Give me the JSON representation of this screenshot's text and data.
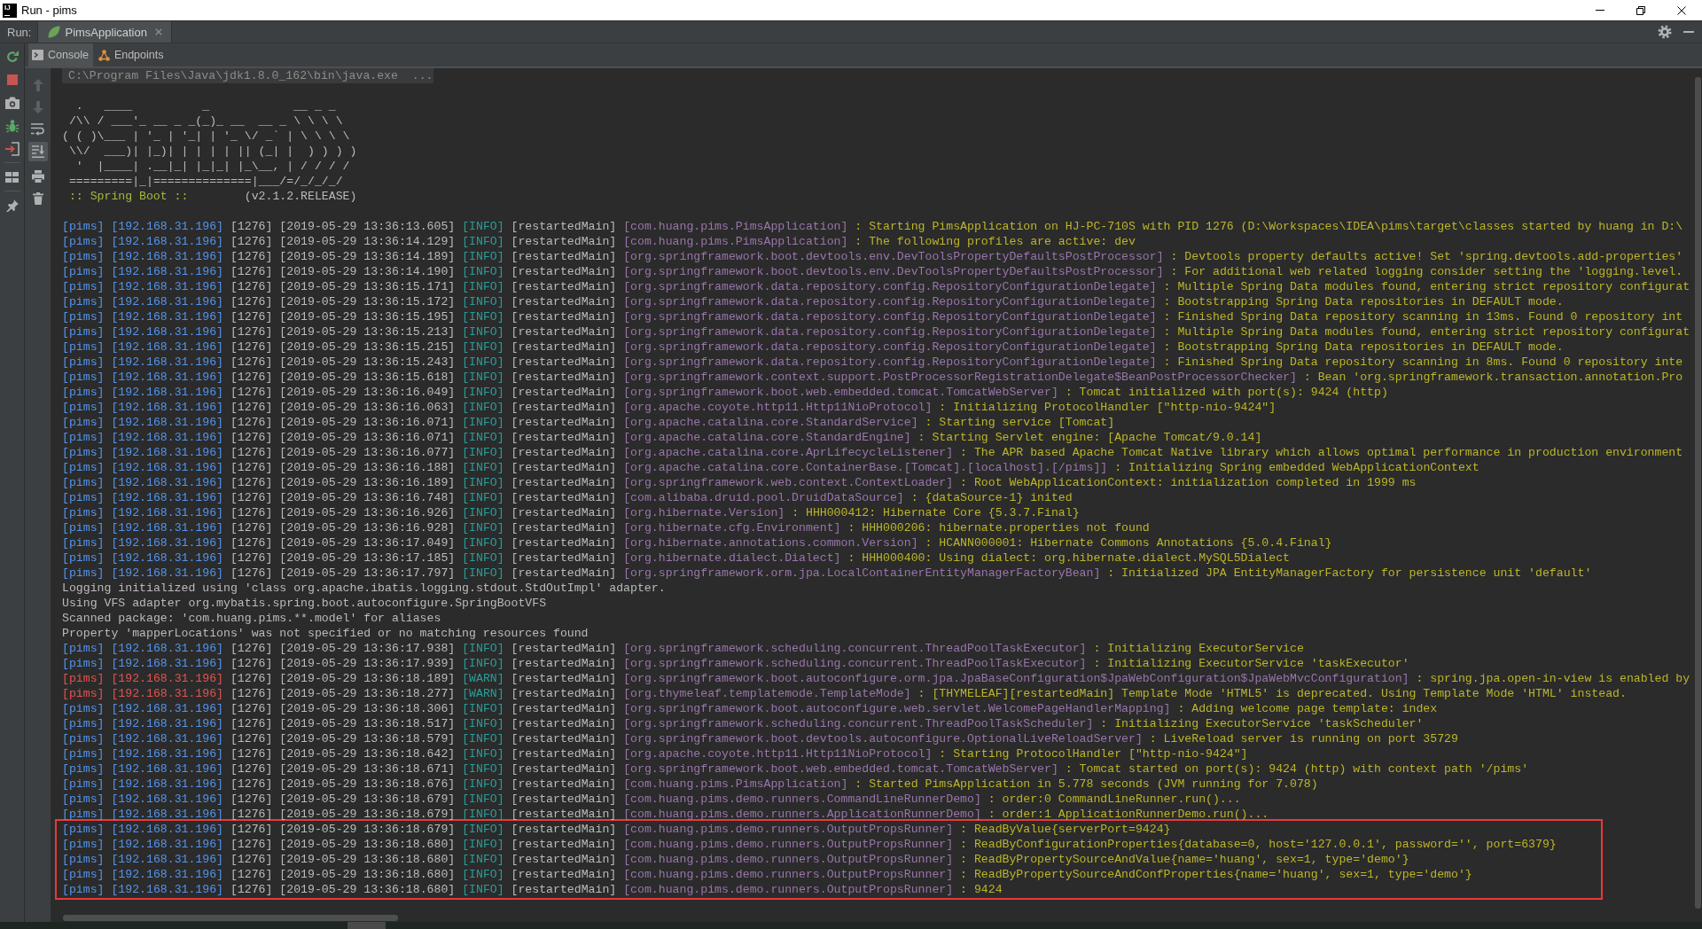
{
  "window": {
    "logo": "IJ",
    "title": "Run - pims"
  },
  "run_panel": {
    "label": "Run:",
    "tabs": [
      {
        "label": "PimsApplication",
        "selected": true
      }
    ]
  },
  "run_toolbar": [
    {
      "kind": "rerun"
    },
    {
      "kind": "stop"
    },
    {
      "kind": "camera"
    },
    {
      "kind": "bug"
    },
    {
      "kind": "exit"
    },
    {
      "kind": "layout"
    },
    {
      "kind": "pin"
    }
  ],
  "console_tabs": [
    {
      "kind": "console",
      "label": "Console",
      "selected": true
    },
    {
      "kind": "endpoints",
      "label": "Endpoints",
      "selected": false
    }
  ],
  "console_toolbar": [
    {
      "kind": "up",
      "disabled": true,
      "on": false
    },
    {
      "kind": "down",
      "disabled": true,
      "on": false
    },
    {
      "kind": "soft_wrap",
      "disabled": false,
      "on": false
    },
    {
      "kind": "scroll_end",
      "disabled": false,
      "on": true
    },
    {
      "kind": "print",
      "disabled": false,
      "on": false
    },
    {
      "kind": "clear",
      "disabled": false,
      "on": false
    }
  ],
  "console": {
    "command": "C:\\Program Files\\Java\\jdk1.8.0_162\\bin\\java.exe  ...",
    "banner": {
      "art": [
        "  .   ____          _            __ _ _",
        " /\\\\ / ___'_ __ _ _(_)_ __  __ _ \\ \\ \\ \\",
        "( ( )\\___ | '_ | '_| | '_ \\/ _` | \\ \\ \\ \\",
        " \\\\/  ___)| |_)| | | | | || (_| |  ) ) ) )",
        "  '  |____| .__|_| |_|_| |_\\__, | / / / /",
        " =========|_|==============|___/=/_/_/_/"
      ],
      "label": ":: Spring Boot ::",
      "version": "(v2.1.2.RELEASE)"
    },
    "lines": [
      {
        "kind": "log",
        "app": "[pims]",
        "host": "[192.168.31.196]",
        "pid": "[1276]",
        "time": "[2019-05-29 13:36:13.605]",
        "severity": "[INFO]",
        "thread": "[restartedMain]",
        "logger": "[com.huang.pims.PimsApplication]",
        "message": ": Starting PimsApplication on HJ-PC-710S with PID 1276 (D:\\Workspaces\\IDEA\\pims\\target\\classes started by huang in D:\\",
        "warning": false,
        "highlighted": false
      },
      {
        "kind": "log",
        "app": "[pims]",
        "host": "[192.168.31.196]",
        "pid": "[1276]",
        "time": "[2019-05-29 13:36:14.129]",
        "severity": "[INFO]",
        "thread": "[restartedMain]",
        "logger": "[com.huang.pims.PimsApplication]",
        "message": ": The following profiles are active: dev",
        "warning": false,
        "highlighted": false
      },
      {
        "kind": "log",
        "app": "[pims]",
        "host": "[192.168.31.196]",
        "pid": "[1276]",
        "time": "[2019-05-29 13:36:14.189]",
        "severity": "[INFO]",
        "thread": "[restartedMain]",
        "logger": "[org.springframework.boot.devtools.env.DevToolsPropertyDefaultsPostProcessor]",
        "message": ": Devtools property defaults active! Set 'spring.devtools.add-properties'",
        "warning": false,
        "highlighted": false
      },
      {
        "kind": "log",
        "app": "[pims]",
        "host": "[192.168.31.196]",
        "pid": "[1276]",
        "time": "[2019-05-29 13:36:14.190]",
        "severity": "[INFO]",
        "thread": "[restartedMain]",
        "logger": "[org.springframework.boot.devtools.env.DevToolsPropertyDefaultsPostProcessor]",
        "message": ": For additional web related logging consider setting the 'logging.level.",
        "warning": false,
        "highlighted": false
      },
      {
        "kind": "log",
        "app": "[pims]",
        "host": "[192.168.31.196]",
        "pid": "[1276]",
        "time": "[2019-05-29 13:36:15.171]",
        "severity": "[INFO]",
        "thread": "[restartedMain]",
        "logger": "[org.springframework.data.repository.config.RepositoryConfigurationDelegate]",
        "message": ": Multiple Spring Data modules found, entering strict repository configurat",
        "warning": false,
        "highlighted": false
      },
      {
        "kind": "log",
        "app": "[pims]",
        "host": "[192.168.31.196]",
        "pid": "[1276]",
        "time": "[2019-05-29 13:36:15.172]",
        "severity": "[INFO]",
        "thread": "[restartedMain]",
        "logger": "[org.springframework.data.repository.config.RepositoryConfigurationDelegate]",
        "message": ": Bootstrapping Spring Data repositories in DEFAULT mode.",
        "warning": false,
        "highlighted": false
      },
      {
        "kind": "log",
        "app": "[pims]",
        "host": "[192.168.31.196]",
        "pid": "[1276]",
        "time": "[2019-05-29 13:36:15.195]",
        "severity": "[INFO]",
        "thread": "[restartedMain]",
        "logger": "[org.springframework.data.repository.config.RepositoryConfigurationDelegate]",
        "message": ": Finished Spring Data repository scanning in 13ms. Found 0 repository int",
        "warning": false,
        "highlighted": false
      },
      {
        "kind": "log",
        "app": "[pims]",
        "host": "[192.168.31.196]",
        "pid": "[1276]",
        "time": "[2019-05-29 13:36:15.213]",
        "severity": "[INFO]",
        "thread": "[restartedMain]",
        "logger": "[org.springframework.data.repository.config.RepositoryConfigurationDelegate]",
        "message": ": Multiple Spring Data modules found, entering strict repository configurat",
        "warning": false,
        "highlighted": false
      },
      {
        "kind": "log",
        "app": "[pims]",
        "host": "[192.168.31.196]",
        "pid": "[1276]",
        "time": "[2019-05-29 13:36:15.215]",
        "severity": "[INFO]",
        "thread": "[restartedMain]",
        "logger": "[org.springframework.data.repository.config.RepositoryConfigurationDelegate]",
        "message": ": Bootstrapping Spring Data repositories in DEFAULT mode.",
        "warning": false,
        "highlighted": false
      },
      {
        "kind": "log",
        "app": "[pims]",
        "host": "[192.168.31.196]",
        "pid": "[1276]",
        "time": "[2019-05-29 13:36:15.243]",
        "severity": "[INFO]",
        "thread": "[restartedMain]",
        "logger": "[org.springframework.data.repository.config.RepositoryConfigurationDelegate]",
        "message": ": Finished Spring Data repository scanning in 8ms. Found 0 repository inte",
        "warning": false,
        "highlighted": false
      },
      {
        "kind": "log",
        "app": "[pims]",
        "host": "[192.168.31.196]",
        "pid": "[1276]",
        "time": "[2019-05-29 13:36:15.618]",
        "severity": "[INFO]",
        "thread": "[restartedMain]",
        "logger": "[org.springframework.context.support.PostProcessorRegistrationDelegate$BeanPostProcessorChecker]",
        "message": ": Bean 'org.springframework.transaction.annotation.Pro",
        "warning": false,
        "highlighted": false
      },
      {
        "kind": "log",
        "app": "[pims]",
        "host": "[192.168.31.196]",
        "pid": "[1276]",
        "time": "[2019-05-29 13:36:16.049]",
        "severity": "[INFO]",
        "thread": "[restartedMain]",
        "logger": "[org.springframework.boot.web.embedded.tomcat.TomcatWebServer]",
        "message": ": Tomcat initialized with port(s): 9424 (http)",
        "warning": false,
        "highlighted": false
      },
      {
        "kind": "log",
        "app": "[pims]",
        "host": "[192.168.31.196]",
        "pid": "[1276]",
        "time": "[2019-05-29 13:36:16.063]",
        "severity": "[INFO]",
        "thread": "[restartedMain]",
        "logger": "[org.apache.coyote.http11.Http11NioProtocol]",
        "message": ": Initializing ProtocolHandler [\"http-nio-9424\"]",
        "warning": false,
        "highlighted": false
      },
      {
        "kind": "log",
        "app": "[pims]",
        "host": "[192.168.31.196]",
        "pid": "[1276]",
        "time": "[2019-05-29 13:36:16.071]",
        "severity": "[INFO]",
        "thread": "[restartedMain]",
        "logger": "[org.apache.catalina.core.StandardService]",
        "message": ": Starting service [Tomcat]",
        "warning": false,
        "highlighted": false
      },
      {
        "kind": "log",
        "app": "[pims]",
        "host": "[192.168.31.196]",
        "pid": "[1276]",
        "time": "[2019-05-29 13:36:16.071]",
        "severity": "[INFO]",
        "thread": "[restartedMain]",
        "logger": "[org.apache.catalina.core.StandardEngine]",
        "message": ": Starting Servlet engine: [Apache Tomcat/9.0.14]",
        "warning": false,
        "highlighted": false
      },
      {
        "kind": "log",
        "app": "[pims]",
        "host": "[192.168.31.196]",
        "pid": "[1276]",
        "time": "[2019-05-29 13:36:16.077]",
        "severity": "[INFO]",
        "thread": "[restartedMain]",
        "logger": "[org.apache.catalina.core.AprLifecycleListener]",
        "message": ": The APR based Apache Tomcat Native library which allows optimal performance in production environment",
        "warning": false,
        "highlighted": false
      },
      {
        "kind": "log",
        "app": "[pims]",
        "host": "[192.168.31.196]",
        "pid": "[1276]",
        "time": "[2019-05-29 13:36:16.188]",
        "severity": "[INFO]",
        "thread": "[restartedMain]",
        "logger": "[org.apache.catalina.core.ContainerBase.[Tomcat].[localhost].[/pims]]",
        "message": ": Initializing Spring embedded WebApplicationContext",
        "warning": false,
        "highlighted": false
      },
      {
        "kind": "log",
        "app": "[pims]",
        "host": "[192.168.31.196]",
        "pid": "[1276]",
        "time": "[2019-05-29 13:36:16.189]",
        "severity": "[INFO]",
        "thread": "[restartedMain]",
        "logger": "[org.springframework.web.context.ContextLoader]",
        "message": ": Root WebApplicationContext: initialization completed in 1999 ms",
        "warning": false,
        "highlighted": false
      },
      {
        "kind": "log",
        "app": "[pims]",
        "host": "[192.168.31.196]",
        "pid": "[1276]",
        "time": "[2019-05-29 13:36:16.748]",
        "severity": "[INFO]",
        "thread": "[restartedMain]",
        "logger": "[com.alibaba.druid.pool.DruidDataSource]",
        "message": ": {dataSource-1} inited",
        "warning": false,
        "highlighted": false
      },
      {
        "kind": "log",
        "app": "[pims]",
        "host": "[192.168.31.196]",
        "pid": "[1276]",
        "time": "[2019-05-29 13:36:16.926]",
        "severity": "[INFO]",
        "thread": "[restartedMain]",
        "logger": "[org.hibernate.Version]",
        "message": ": HHH000412: Hibernate Core {5.3.7.Final}",
        "warning": false,
        "highlighted": false
      },
      {
        "kind": "log",
        "app": "[pims]",
        "host": "[192.168.31.196]",
        "pid": "[1276]",
        "time": "[2019-05-29 13:36:16.928]",
        "severity": "[INFO]",
        "thread": "[restartedMain]",
        "logger": "[org.hibernate.cfg.Environment]",
        "message": ": HHH000206: hibernate.properties not found",
        "warning": false,
        "highlighted": false
      },
      {
        "kind": "log",
        "app": "[pims]",
        "host": "[192.168.31.196]",
        "pid": "[1276]",
        "time": "[2019-05-29 13:36:17.049]",
        "severity": "[INFO]",
        "thread": "[restartedMain]",
        "logger": "[org.hibernate.annotations.common.Version]",
        "message": ": HCANN000001: Hibernate Commons Annotations {5.0.4.Final}",
        "warning": false,
        "highlighted": false
      },
      {
        "kind": "log",
        "app": "[pims]",
        "host": "[192.168.31.196]",
        "pid": "[1276]",
        "time": "[2019-05-29 13:36:17.185]",
        "severity": "[INFO]",
        "thread": "[restartedMain]",
        "logger": "[org.hibernate.dialect.Dialect]",
        "message": ": HHH000400: Using dialect: org.hibernate.dialect.MySQL5Dialect",
        "warning": false,
        "highlighted": false
      },
      {
        "kind": "log",
        "app": "[pims]",
        "host": "[192.168.31.196]",
        "pid": "[1276]",
        "time": "[2019-05-29 13:36:17.797]",
        "severity": "[INFO]",
        "thread": "[restartedMain]",
        "logger": "[org.springframework.orm.jpa.LocalContainerEntityManagerFactoryBean]",
        "message": ": Initialized JPA EntityManagerFactory for persistence unit 'default'",
        "warning": false,
        "highlighted": false
      },
      {
        "kind": "plain",
        "text": "Logging initialized using 'class org.apache.ibatis.logging.stdout.StdOutImpl' adapter.",
        "highlighted": false
      },
      {
        "kind": "plain",
        "text": "Using VFS adapter org.mybatis.spring.boot.autoconfigure.SpringBootVFS",
        "highlighted": false
      },
      {
        "kind": "plain",
        "text": "Scanned package: 'com.huang.pims.**.model' for aliases",
        "highlighted": false
      },
      {
        "kind": "plain",
        "text": "Property 'mapperLocations' was not specified or no matching resources found",
        "highlighted": false
      },
      {
        "kind": "log",
        "app": "[pims]",
        "host": "[192.168.31.196]",
        "pid": "[1276]",
        "time": "[2019-05-29 13:36:17.938]",
        "severity": "[INFO]",
        "thread": "[restartedMain]",
        "logger": "[org.springframework.scheduling.concurrent.ThreadPoolTaskExecutor]",
        "message": ": Initializing ExecutorService",
        "warning": false,
        "highlighted": false
      },
      {
        "kind": "log",
        "app": "[pims]",
        "host": "[192.168.31.196]",
        "pid": "[1276]",
        "time": "[2019-05-29 13:36:17.939]",
        "severity": "[INFO]",
        "thread": "[restartedMain]",
        "logger": "[org.springframework.scheduling.concurrent.ThreadPoolTaskExecutor]",
        "message": ": Initializing ExecutorService 'taskExecutor'",
        "warning": false,
        "highlighted": false
      },
      {
        "kind": "log",
        "app": "[pims]",
        "host": "[192.168.31.196]",
        "pid": "[1276]",
        "time": "[2019-05-29 13:36:18.189]",
        "severity": "[WARN]",
        "thread": "[restartedMain]",
        "logger": "[org.springframework.boot.autoconfigure.orm.jpa.JpaBaseConfiguration$JpaWebConfiguration$JpaWebMvcConfiguration]",
        "message": ": spring.jpa.open-in-view is enabled by",
        "warning": true,
        "highlighted": false
      },
      {
        "kind": "log",
        "app": "[pims]",
        "host": "[192.168.31.196]",
        "pid": "[1276]",
        "time": "[2019-05-29 13:36:18.277]",
        "severity": "[WARN]",
        "thread": "[restartedMain]",
        "logger": "[org.thymeleaf.templatemode.TemplateMode]",
        "message": ": [THYMELEAF][restartedMain] Template Mode 'HTML5' is deprecated. Using Template Mode 'HTML' instead.",
        "warning": true,
        "highlighted": false
      },
      {
        "kind": "log",
        "app": "[pims]",
        "host": "[192.168.31.196]",
        "pid": "[1276]",
        "time": "[2019-05-29 13:36:18.306]",
        "severity": "[INFO]",
        "thread": "[restartedMain]",
        "logger": "[org.springframework.boot.autoconfigure.web.servlet.WelcomePageHandlerMapping]",
        "message": ": Adding welcome page template: index",
        "warning": false,
        "highlighted": false
      },
      {
        "kind": "log",
        "app": "[pims]",
        "host": "[192.168.31.196]",
        "pid": "[1276]",
        "time": "[2019-05-29 13:36:18.517]",
        "severity": "[INFO]",
        "thread": "[restartedMain]",
        "logger": "[org.springframework.scheduling.concurrent.ThreadPoolTaskScheduler]",
        "message": ": Initializing ExecutorService 'taskScheduler'",
        "warning": false,
        "highlighted": false
      },
      {
        "kind": "log",
        "app": "[pims]",
        "host": "[192.168.31.196]",
        "pid": "[1276]",
        "time": "[2019-05-29 13:36:18.579]",
        "severity": "[INFO]",
        "thread": "[restartedMain]",
        "logger": "[org.springframework.boot.devtools.autoconfigure.OptionalLiveReloadServer]",
        "message": ": LiveReload server is running on port 35729",
        "warning": false,
        "highlighted": false
      },
      {
        "kind": "log",
        "app": "[pims]",
        "host": "[192.168.31.196]",
        "pid": "[1276]",
        "time": "[2019-05-29 13:36:18.642]",
        "severity": "[INFO]",
        "thread": "[restartedMain]",
        "logger": "[org.apache.coyote.http11.Http11NioProtocol]",
        "message": ": Starting ProtocolHandler [\"http-nio-9424\"]",
        "warning": false,
        "highlighted": false
      },
      {
        "kind": "log",
        "app": "[pims]",
        "host": "[192.168.31.196]",
        "pid": "[1276]",
        "time": "[2019-05-29 13:36:18.671]",
        "severity": "[INFO]",
        "thread": "[restartedMain]",
        "logger": "[org.springframework.boot.web.embedded.tomcat.TomcatWebServer]",
        "message": ": Tomcat started on port(s): 9424 (http) with context path '/pims'",
        "warning": false,
        "highlighted": false
      },
      {
        "kind": "log",
        "app": "[pims]",
        "host": "[192.168.31.196]",
        "pid": "[1276]",
        "time": "[2019-05-29 13:36:18.676]",
        "severity": "[INFO]",
        "thread": "[restartedMain]",
        "logger": "[com.huang.pims.PimsApplication]",
        "message": ": Started PimsApplication in 5.778 seconds (JVM running for 7.078)",
        "warning": false,
        "highlighted": false
      },
      {
        "kind": "log",
        "app": "[pims]",
        "host": "[192.168.31.196]",
        "pid": "[1276]",
        "time": "[2019-05-29 13:36:18.679]",
        "severity": "[INFO]",
        "thread": "[restartedMain]",
        "logger": "[com.huang.pims.demo.runners.CommandLineRunnerDemo]",
        "message": ": order:0 CommandLineRunner.run()...",
        "warning": false,
        "highlighted": false
      },
      {
        "kind": "log",
        "app": "[pims]",
        "host": "[192.168.31.196]",
        "pid": "[1276]",
        "time": "[2019-05-29 13:36:18.679]",
        "severity": "[INFO]",
        "thread": "[restartedMain]",
        "logger": "[com.huang.pims.demo.runners.ApplicationRunnerDemo]",
        "message": ": order:1 ApplicationRunnerDemo.run()...",
        "warning": false,
        "highlighted": false
      },
      {
        "kind": "log",
        "app": "[pims]",
        "host": "[192.168.31.196]",
        "pid": "[1276]",
        "time": "[2019-05-29 13:36:18.679]",
        "severity": "[INFO]",
        "thread": "[restartedMain]",
        "logger": "[com.huang.pims.demo.runners.OutputPropsRunner]",
        "message": ": ReadByValue{serverPort=9424}",
        "warning": false,
        "highlighted": true
      },
      {
        "kind": "log",
        "app": "[pims]",
        "host": "[192.168.31.196]",
        "pid": "[1276]",
        "time": "[2019-05-29 13:36:18.680]",
        "severity": "[INFO]",
        "thread": "[restartedMain]",
        "logger": "[com.huang.pims.demo.runners.OutputPropsRunner]",
        "message": ": ReadByConfigurationProperties{database=0, host='127.0.0.1', password='', port=6379}",
        "warning": false,
        "highlighted": true
      },
      {
        "kind": "log",
        "app": "[pims]",
        "host": "[192.168.31.196]",
        "pid": "[1276]",
        "time": "[2019-05-29 13:36:18.680]",
        "severity": "[INFO]",
        "thread": "[restartedMain]",
        "logger": "[com.huang.pims.demo.runners.OutputPropsRunner]",
        "message": ": ReadByPropertySourceAndValue{name='huang', sex=1, type='demo'}",
        "warning": false,
        "highlighted": true
      },
      {
        "kind": "log",
        "app": "[pims]",
        "host": "[192.168.31.196]",
        "pid": "[1276]",
        "time": "[2019-05-29 13:36:18.680]",
        "severity": "[INFO]",
        "thread": "[restartedMain]",
        "logger": "[com.huang.pims.demo.runners.OutputPropsRunner]",
        "message": ": ReadByPropertySourceAndConfProperties{name='huang', sex=1, type='demo'}",
        "warning": false,
        "highlighted": true
      },
      {
        "kind": "log",
        "app": "[pims]",
        "host": "[192.168.31.196]",
        "pid": "[1276]",
        "time": "[2019-05-29 13:36:18.680]",
        "severity": "[INFO]",
        "thread": "[restartedMain]",
        "logger": "[com.huang.pims.demo.runners.OutputPropsRunner]",
        "message": ": 9424",
        "warning": false,
        "highlighted": true
      }
    ]
  }
}
